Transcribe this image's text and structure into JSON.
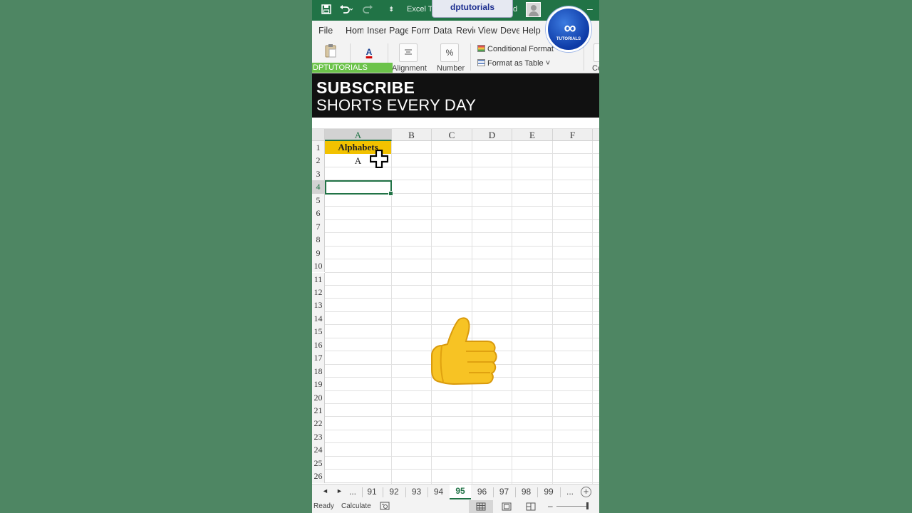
{
  "titlebar": {
    "save_icon": "save-icon",
    "undo_icon": "undo-icon",
    "redo_icon": "redo-icon",
    "title_left": "Excel Tr",
    "title_right": "d",
    "channel_tag": "dptutorials",
    "minimize": "–"
  },
  "menu": {
    "tabs": [
      "File",
      "Hom",
      "Inser",
      "Page",
      "Form",
      "Data",
      "Revie",
      "View",
      "Deve",
      "Help"
    ]
  },
  "ribbon": {
    "alignment_label": "Alignment",
    "number_label": "Number",
    "percent_symbol": "%",
    "font_color_symbol": "A",
    "conditional_formatting": "Conditional Format",
    "format_as_table": "Format as Table ˅",
    "cells_label": "Ce",
    "channel_strip": "DPTUTORIALS"
  },
  "logo": {
    "mark": "∞",
    "text": "TUTORIALS"
  },
  "banner": {
    "line1": "SUBSCRIBE",
    "line2": "SHORTS EVERY DAY"
  },
  "sheet": {
    "columns": [
      "A",
      "B",
      "C",
      "D",
      "E",
      "F"
    ],
    "rows": [
      "1",
      "2",
      "3",
      "4",
      "5",
      "6",
      "7",
      "8",
      "9",
      "10",
      "11",
      "12",
      "13",
      "14",
      "15",
      "16",
      "17",
      "18",
      "19",
      "20",
      "21",
      "22",
      "23",
      "24",
      "25",
      "26"
    ],
    "selected_row": "4",
    "selected_column": "A",
    "cells": {
      "A1": "Alphabets",
      "A2": "A"
    },
    "header_color": "#f2c200",
    "accent_color": "#217346"
  },
  "sheet_tabs": {
    "prev": "◄",
    "next": "►",
    "ellipsis": "...",
    "names": [
      "91",
      "92",
      "93",
      "94",
      "95",
      "96",
      "97",
      "98",
      "99"
    ],
    "active": "95",
    "add": "+"
  },
  "status": {
    "ready": "Ready",
    "calculate": "Calculate",
    "zoom_minus": "–"
  }
}
